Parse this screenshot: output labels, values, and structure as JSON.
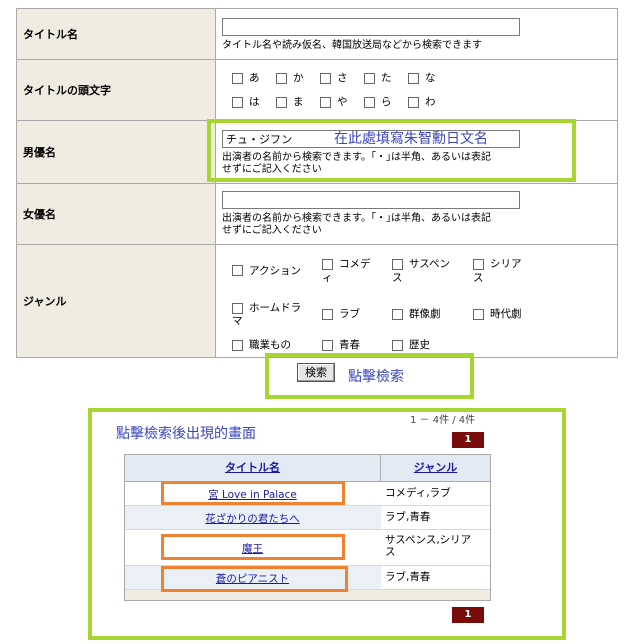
{
  "form": {
    "title_row": {
      "label": "タイトル名",
      "value": "",
      "help": "タイトル名や読み仮名、韓国放送局などから検索できます"
    },
    "initial_row": {
      "label": "タイトルの頭文字",
      "options": [
        "あ",
        "か",
        "さ",
        "た",
        "な",
        "は",
        "ま",
        "や",
        "ら",
        "わ"
      ]
    },
    "actor_row": {
      "label": "男優名",
      "value": "チュ・ジフン",
      "help_line1": "出演者の名前から検索できます。｢・｣は半角、あるいは表記",
      "help_line2": "せずにご記入ください"
    },
    "actress_row": {
      "label": "女優名",
      "value": "",
      "help_line1": "出演者の名前から検索できます。｢・｣は半角、あるいは表記",
      "help_line2": "せずにご記入ください"
    },
    "genre_row": {
      "label": "ジャンル",
      "options": [
        {
          "line1": "アクション",
          "line2": ""
        },
        {
          "line1": "コメデ",
          "line2": "ィ"
        },
        {
          "line1": "サスペン",
          "line2": "ス"
        },
        {
          "line1": "シリア",
          "line2": "ス"
        },
        {
          "line1": "ホームドラ",
          "line2": "マ"
        },
        {
          "line1": "ラブ",
          "line2": ""
        },
        {
          "line1": "群像劇",
          "line2": ""
        },
        {
          "line1": "時代劇",
          "line2": ""
        },
        {
          "line1": "職業もの",
          "line2": ""
        },
        {
          "line1": "青春",
          "line2": ""
        },
        {
          "line1": "歴史",
          "line2": ""
        }
      ]
    }
  },
  "annotations": {
    "actor_hint": "在此處填寫朱智勳日文名",
    "search_hint": "點擊檢索",
    "results_hint": "點擊檢索後出現的畫面"
  },
  "search_button": {
    "label": "検索"
  },
  "results": {
    "count_text": "1 － 4件 / 4件",
    "page_top": "1",
    "page_bottom": "1",
    "headers": {
      "title": "タイトル名",
      "genre": "ジャンル"
    },
    "rows": [
      {
        "title": "宮 Love in Palace",
        "genre": "コメディ,ラブ"
      },
      {
        "title": "花ざかりの君たちへ",
        "genre": "ラブ,青春"
      },
      {
        "title": "魔王",
        "genre": "サスペンス,シリア",
        "genre2": "ス"
      },
      {
        "title": "蒼のピアニスト",
        "genre": "ラブ,青春"
      }
    ]
  },
  "colors": {
    "label_bg": "#f1ece1",
    "annotation_green": "#a8d630",
    "annotation_orange": "#f08130",
    "annotation_text_blue": "#3a44c0",
    "link_blue": "#1a1aa6",
    "page_button": "#7a0b0b"
  }
}
